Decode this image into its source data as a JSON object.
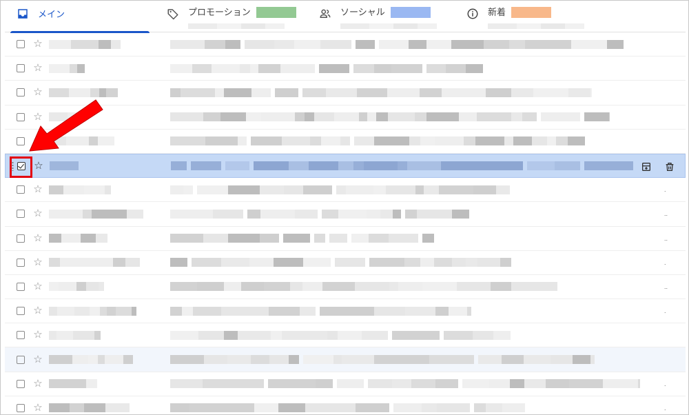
{
  "tabs": [
    {
      "label": "メイン",
      "icon": "inbox-icon",
      "active": true
    },
    {
      "label": "プロモーション",
      "icon": "tag-icon",
      "badge_color": "#93c993"
    },
    {
      "label": "ソーシャル",
      "icon": "people-icon",
      "badge_color": "#9ab8f2"
    },
    {
      "label": "新着",
      "icon": "info-icon",
      "badge_color": "#f8b88a"
    }
  ],
  "colors": {
    "accent": "#1a56c9",
    "selected_row": "#c5d9f6",
    "highlight_red": "#e3000f"
  },
  "selected_row_index": 5,
  "row_actions": [
    "archive-icon",
    "trash-icon"
  ],
  "rows": [
    {
      "trail": ""
    },
    {
      "trail": ""
    },
    {
      "trail": ""
    },
    {
      "trail": ""
    },
    {
      "trail": ""
    },
    {
      "trail": ""
    },
    {
      "trail": "."
    },
    {
      "trail": ".."
    },
    {
      "trail": ".."
    },
    {
      "trail": "."
    },
    {
      "trail": ".."
    },
    {
      "trail": "."
    },
    {
      "trail": ""
    },
    {
      "trail": ""
    },
    {
      "trail": "."
    },
    {
      "trail": "."
    }
  ]
}
